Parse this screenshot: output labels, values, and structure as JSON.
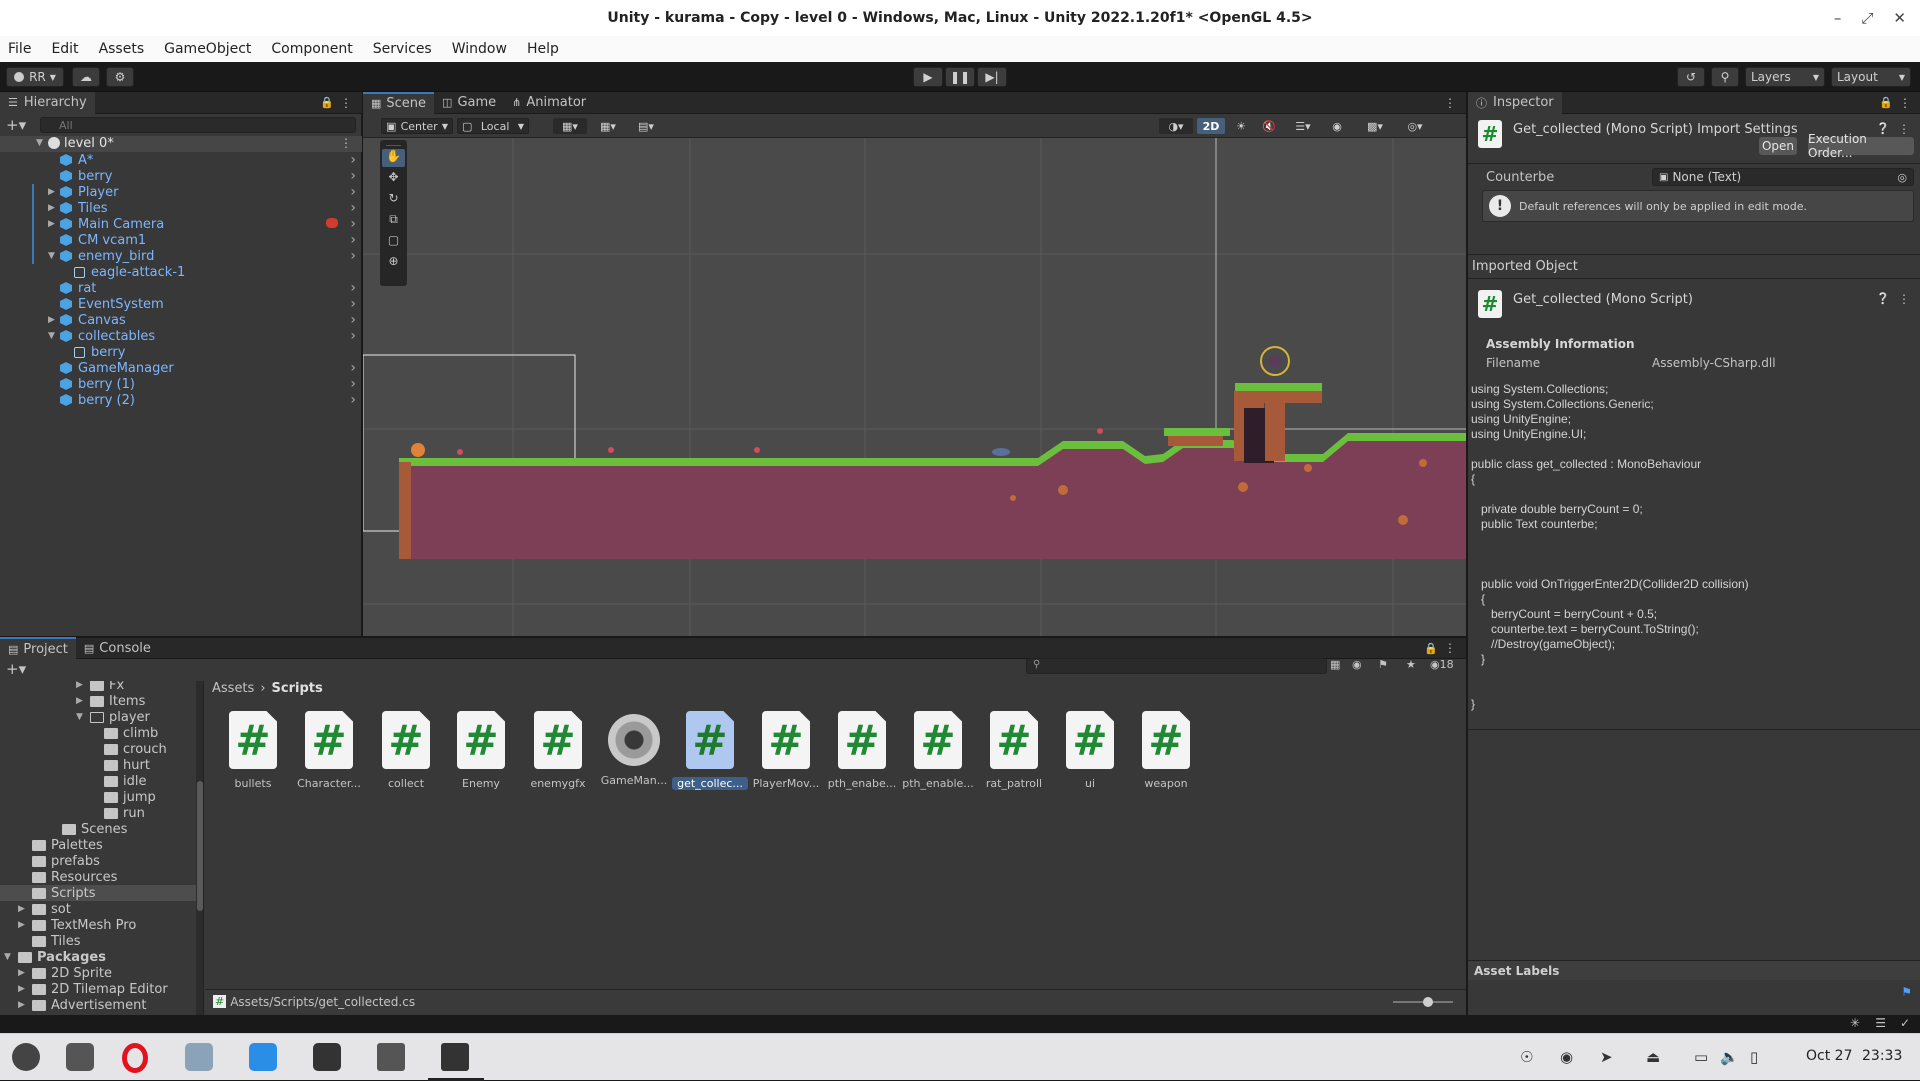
{
  "title": "Unity - kurama - Copy - level 0 - Windows, Mac, Linux - Unity 2022.1.20f1* <OpenGL 4.5>",
  "menu": [
    "File",
    "Edit",
    "Assets",
    "GameObject",
    "Component",
    "Services",
    "Window",
    "Help"
  ],
  "toolbar": {
    "account": "RR",
    "layers": "Layers",
    "layout": "Layout"
  },
  "hierarchy": {
    "tab": "Hierarchy",
    "search_placeholder": "All",
    "scene": "level 0*",
    "items": [
      {
        "label": "A*"
      },
      {
        "label": "berry"
      },
      {
        "label": "Player"
      },
      {
        "label": "Tiles"
      },
      {
        "label": "Main Camera"
      },
      {
        "label": "CM vcam1"
      },
      {
        "label": "enemy_bird"
      },
      {
        "label": "eagle-attack-1"
      },
      {
        "label": "rat"
      },
      {
        "label": "EventSystem"
      },
      {
        "label": "Canvas"
      },
      {
        "label": "collectables"
      },
      {
        "label": "berry"
      },
      {
        "label": "GameManager"
      },
      {
        "label": "berry (1)"
      },
      {
        "label": "berry (2)"
      }
    ]
  },
  "scene": {
    "tabs": [
      "Scene",
      "Game",
      "Animator"
    ],
    "pivot": "Center",
    "space": "Local",
    "mode2d": "2D"
  },
  "inspector": {
    "tab": "Inspector",
    "header": "Get_collected (Mono Script) Import Settings",
    "open": "Open",
    "exec_order": "Execution Order...",
    "field_label": "Counterbe",
    "field_value": "None (Text)",
    "note": "Default references will only be applied in edit mode.",
    "imported": "Imported Object",
    "imported_name": "Get_collected (Mono Script)",
    "asm_info": "Assembly Information",
    "filename_label": "Filename",
    "filename_value": "Assembly-CSharp.dll",
    "code": "using System.Collections;\nusing System.Collections.Generic;\nusing UnityEngine;\nusing UnityEngine.UI;\n\npublic class get_collected : MonoBehaviour\n{\n\n   private double berryCount = 0;\n   public Text counterbe;\n\n\n\n   public void OnTriggerEnter2D(Collider2D collision)\n   {\n      berryCount = berryCount + 0.5;\n      counterbe.text = berryCount.ToString();\n      //Destroy(gameObject);\n   }\n\n\n}",
    "asset_labels": "Asset Labels"
  },
  "project": {
    "tabs": [
      "Project",
      "Console"
    ],
    "count": "18",
    "tree": [
      "Fx",
      "Items",
      "player",
      "climb",
      "crouch",
      "hurt",
      "idle",
      "jump",
      "run",
      "Scenes",
      "Palettes",
      "prefabs",
      "Resources",
      "Scripts",
      "sot",
      "TextMesh Pro",
      "Tiles",
      "Packages",
      "2D Sprite",
      "2D Tilemap Editor",
      "Advertisement"
    ],
    "breadcrumb": [
      "Assets",
      "Scripts"
    ],
    "assets": [
      "bullets",
      "Character...",
      "collect",
      "Enemy",
      "enemygfx",
      "GameMan...",
      "get_collec...",
      "PlayerMov...",
      "pth_enabe...",
      "pth_enable...",
      "rat_patroll",
      "ui",
      "weapon"
    ],
    "path": "Assets/Scripts/get_collected.cs"
  },
  "taskbar": {
    "date": "Oct 27",
    "time": "23:33"
  },
  "colors": {
    "accent": "#3a79bb",
    "hier_text": "#7cb6ff",
    "ground": "#7d3f55",
    "grass": "#6abf3c"
  }
}
